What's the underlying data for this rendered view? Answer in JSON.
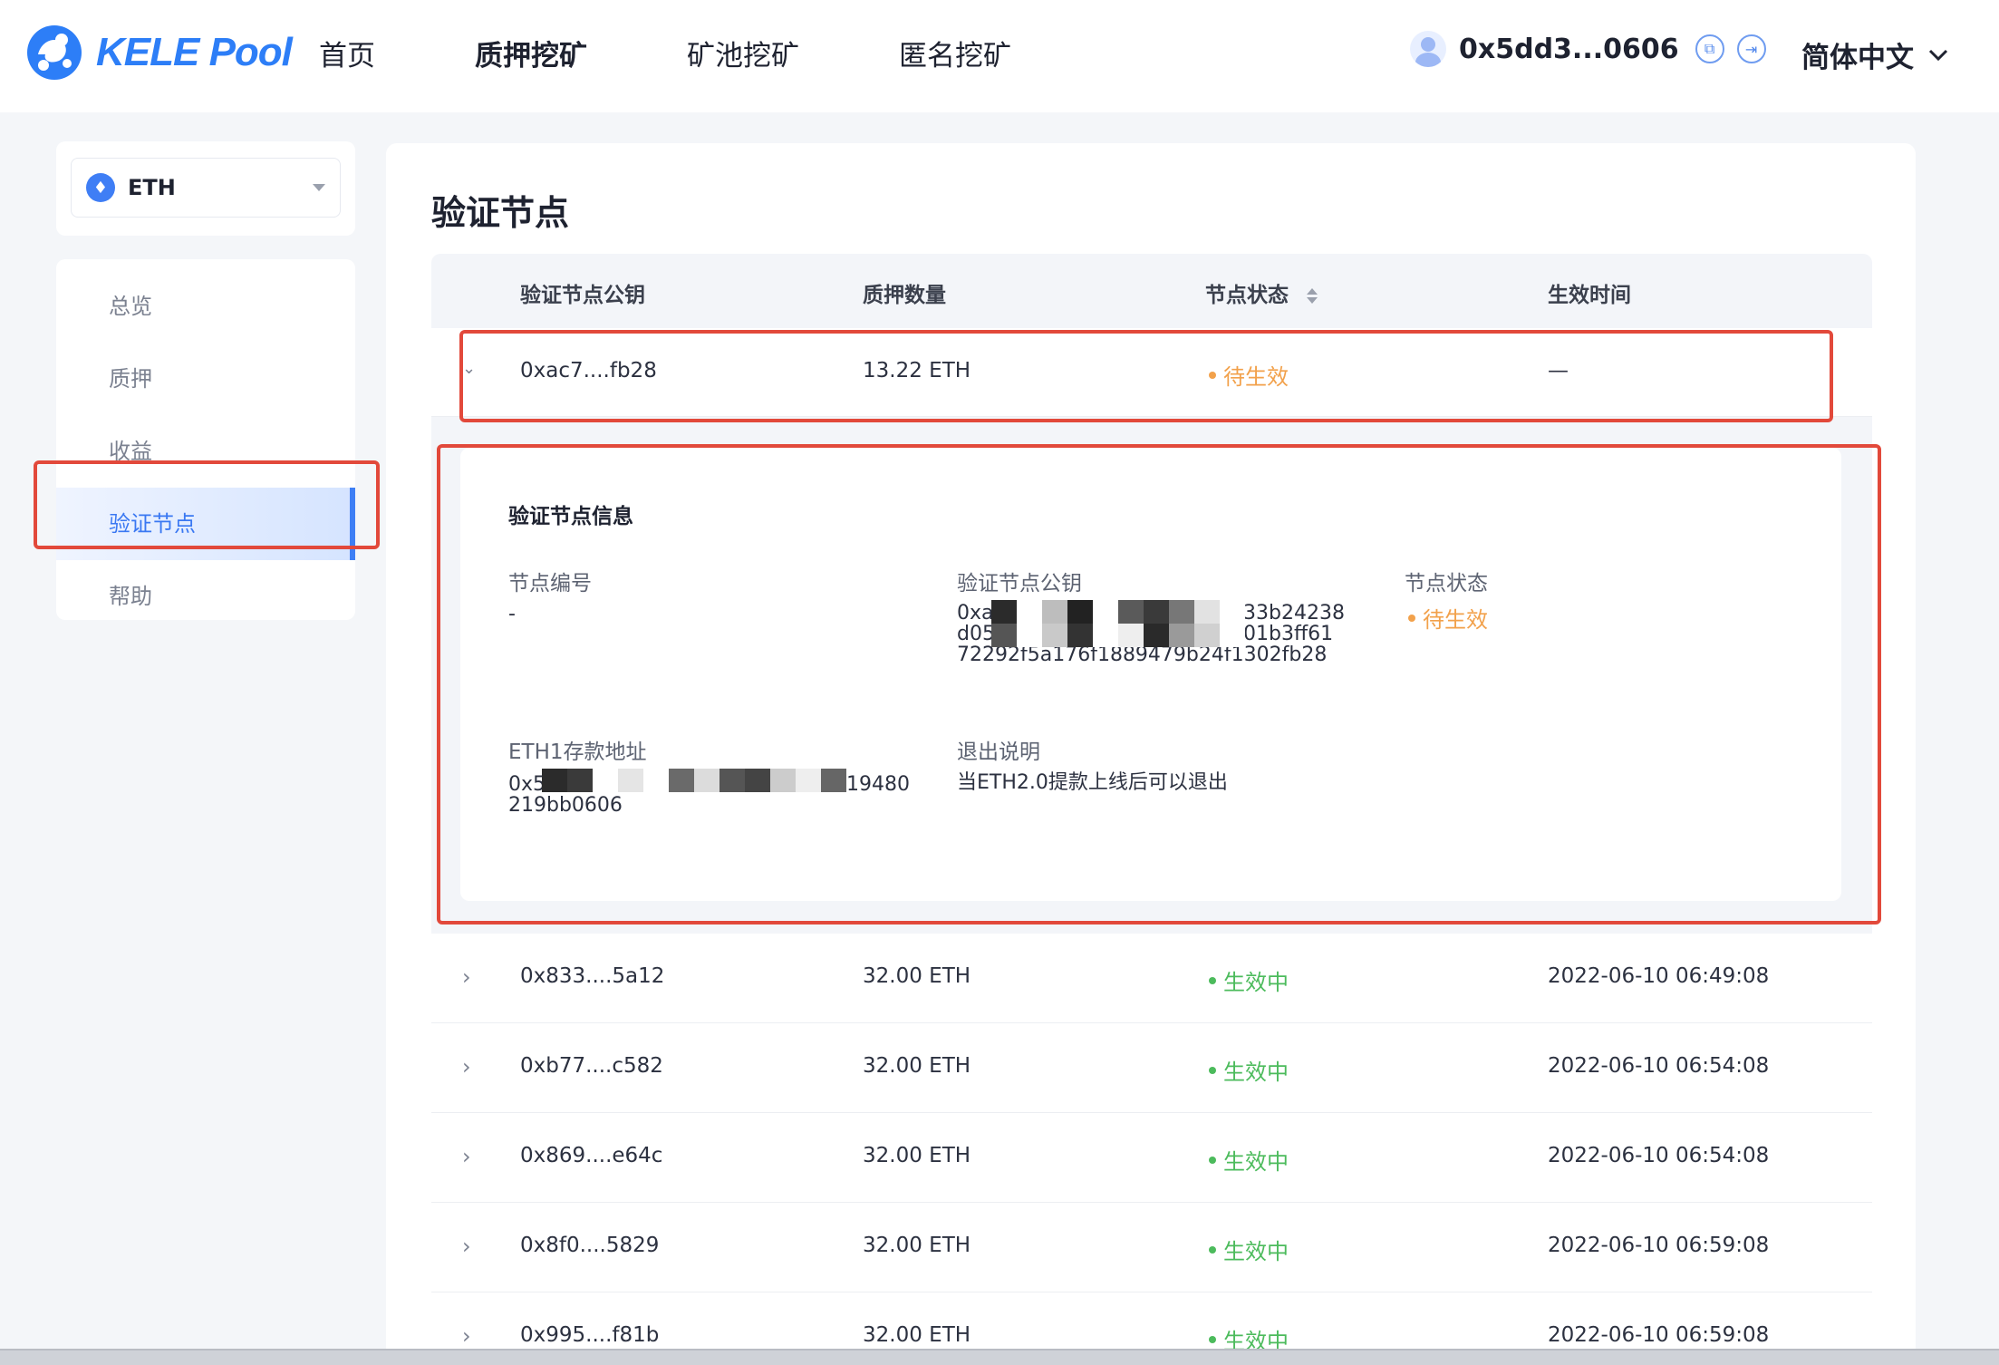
{
  "header": {
    "logo_text": "KELE Pool",
    "nav": [
      "首页",
      "质押挖矿",
      "矿池挖矿",
      "匿名挖矿"
    ],
    "active_nav_index": 1,
    "address": "0x5dd3...0606",
    "language": "简体中文"
  },
  "sidebar": {
    "coin": "ETH",
    "items": [
      "总览",
      "质押",
      "收益",
      "验证节点",
      "帮助"
    ],
    "active_index": 3
  },
  "main": {
    "title": "验证节点",
    "columns": [
      "验证节点公钥",
      "质押数量",
      "节点状态",
      "生效时间"
    ],
    "expanded_row": {
      "key": "0xac7....fb28",
      "amount": "13.22 ETH",
      "status": "待生效",
      "time": "—"
    },
    "detail": {
      "title": "验证节点信息",
      "node_no_label": "节点编号",
      "node_no_value": "-",
      "pubkey_label": "验证节点公钥",
      "pubkey_lines": [
        "0xac787",
        "33b24238",
        "d05",
        "01b3ff61",
        "72292f5a176f1889479b24f1302fb28"
      ],
      "status_label": "节点状态",
      "status_value": "待生效",
      "deposit_label": "ETH1存款地址",
      "deposit_lines": [
        "0x5",
        "d19480",
        "219bb0606"
      ],
      "exit_label": "退出说明",
      "exit_value": "当ETH2.0提款上线后可以退出"
    },
    "rows": [
      {
        "key": "0x833....5a12",
        "amount": "32.00 ETH",
        "status": "生效中",
        "time": "2022-06-10 06:49:08"
      },
      {
        "key": "0xb77....c582",
        "amount": "32.00 ETH",
        "status": "生效中",
        "time": "2022-06-10 06:54:08"
      },
      {
        "key": "0x869....e64c",
        "amount": "32.00 ETH",
        "status": "生效中",
        "time": "2022-06-10 06:54:08"
      },
      {
        "key": "0x8f0....5829",
        "amount": "32.00 ETH",
        "status": "生效中",
        "time": "2022-06-10 06:59:08"
      },
      {
        "key": "0x995....f81b",
        "amount": "32.00 ETH",
        "status": "生效中",
        "time": "2022-06-10 06:59:08"
      }
    ]
  },
  "colors": {
    "accent": "#3a78f2",
    "active_status": "#4cbb5c",
    "pending_status": "#f2a14b",
    "highlight_box": "#e2493b"
  }
}
